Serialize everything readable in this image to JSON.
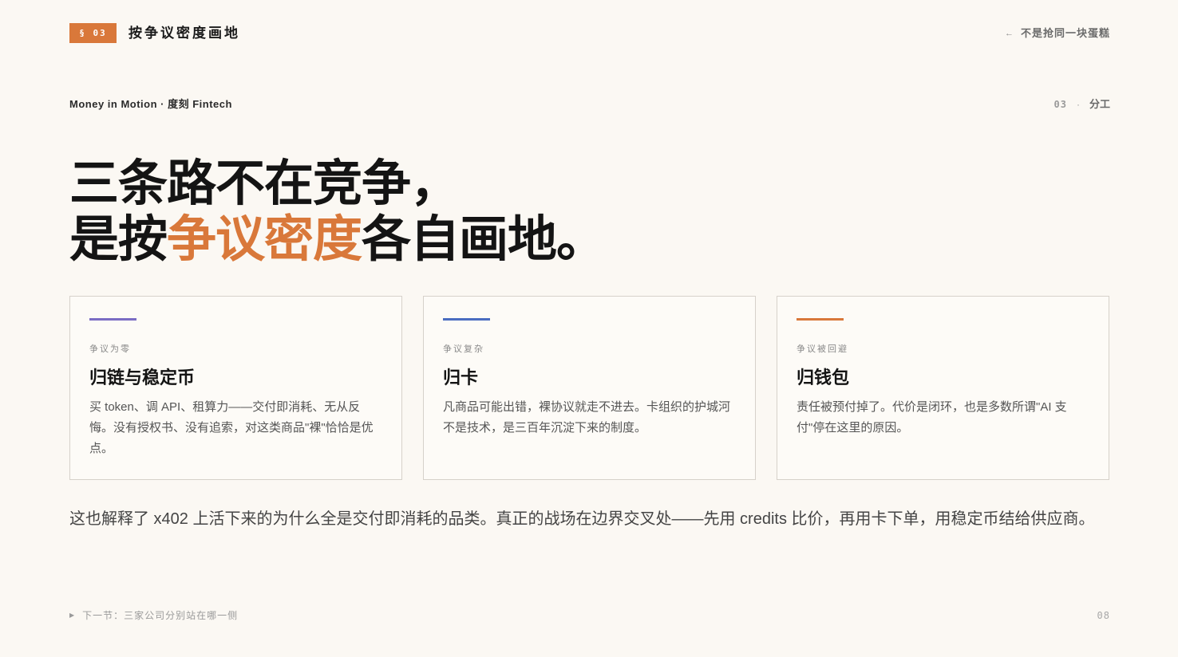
{
  "header": {
    "section_badge": "§ 03",
    "section_title": "按争议密度画地",
    "back_link": "不是抢同一块蛋糕"
  },
  "meta": {
    "brand": "Money in Motion · 度刻 Fintech",
    "page_num": "03",
    "page_dot": "·",
    "page_label": "分工"
  },
  "headline": {
    "line1": "三条路不在竞争，",
    "line2_pre": "是按",
    "line2_accent": "争议密度",
    "line2_post": "各自画地。"
  },
  "colors": {
    "accent": "#d9783a",
    "card1_bar": "#7b6cc4",
    "card2_bar": "#4a6cc0",
    "card3_bar": "#d9783a"
  },
  "cards": [
    {
      "kicker": "争议为零",
      "title": "归链与稳定币",
      "body": "买 token、调 API、租算力——交付即消耗、无从反悔。没有授权书、没有追索，对这类商品\"裸\"恰恰是优点。"
    },
    {
      "kicker": "争议复杂",
      "title": "归卡",
      "body": "凡商品可能出错，裸协议就走不进去。卡组织的护城河不是技术，是三百年沉淀下来的制度。"
    },
    {
      "kicker": "争议被回避",
      "title": "归钱包",
      "body": "责任被预付掉了。代价是闭环，也是多数所谓\"AI 支付\"停在这里的原因。"
    }
  ],
  "summary": "这也解释了 x402 上活下来的为什么全是交付即消耗的品类。真正的战场在边界交叉处——先用 credits 比价，再用卡下单，用稳定币结给供应商。",
  "footer": {
    "next_label": "下一节：三家公司分别站在哪一侧",
    "page_number": "08"
  }
}
